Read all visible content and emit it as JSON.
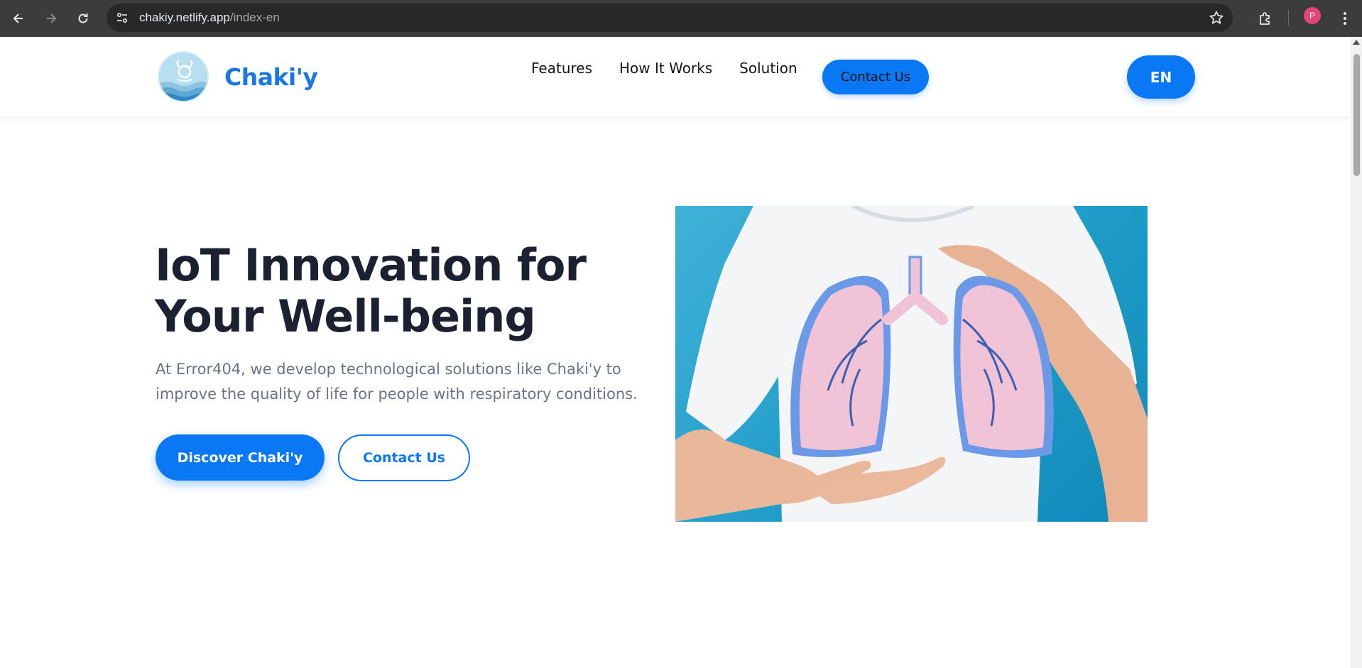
{
  "browser": {
    "url_host": "chakiy.netlify.app",
    "url_path": "/index-en",
    "profile_initial": "P",
    "icons": [
      "back-arrow-icon",
      "forward-arrow-icon",
      "reload-icon",
      "site-info-icon",
      "star-icon",
      "extensions-icon",
      "menu-dots-icon"
    ]
  },
  "header": {
    "brand_name": "Chaki'y",
    "nav": [
      {
        "label": "Features"
      },
      {
        "label": "How It Works"
      },
      {
        "label": "Solution"
      }
    ],
    "contact_label": "Contact Us",
    "language": "EN"
  },
  "hero": {
    "title_line1": "IoT Innovation for",
    "title_line2": "Your Well-being",
    "text": "At Error404, we develop technological solutions like Chaki'y to improve the quality of life for people with respiratory conditions.",
    "primary_button": "Discover Chaki'y",
    "secondary_button": "Contact Us"
  },
  "colors": {
    "accent": "#0a77f5",
    "brand_text": "#1a77e6",
    "heading": "#1b2130",
    "body_text": "#6b7386",
    "image_background": "#1f9cc8",
    "lungs": "#f0c4d6",
    "lung_outline": "#6c98e8"
  }
}
